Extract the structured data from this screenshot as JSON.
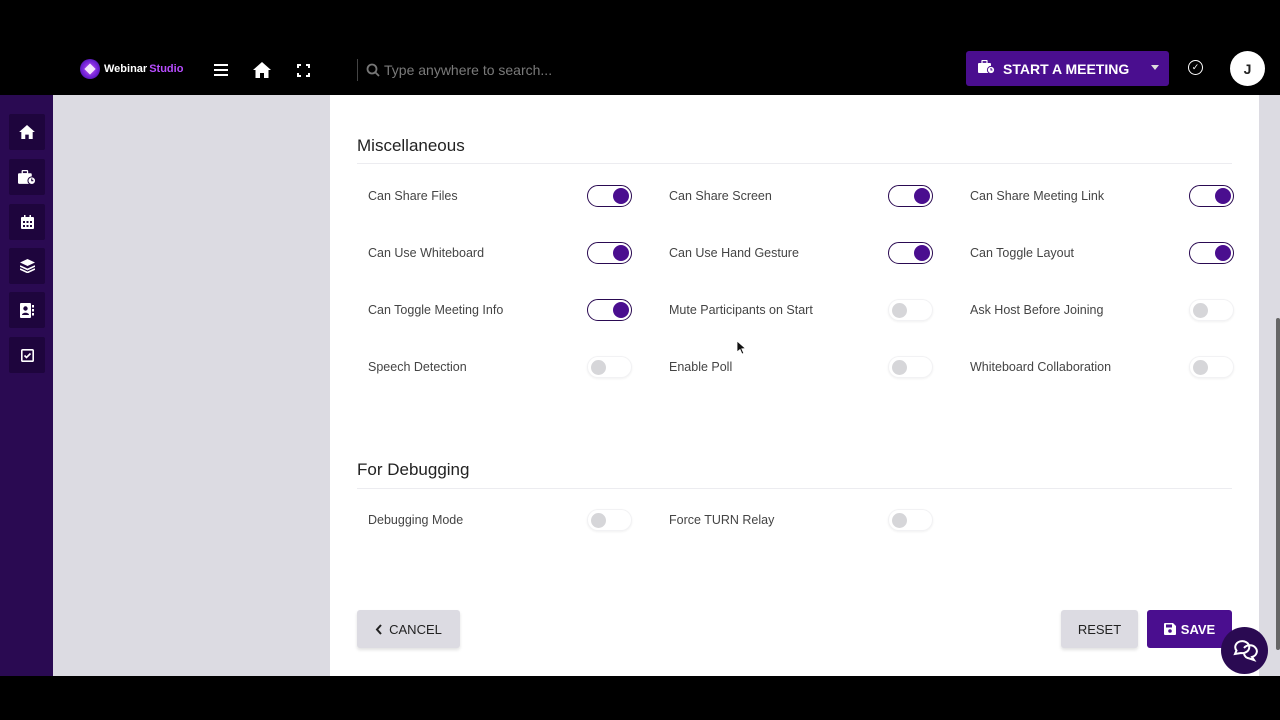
{
  "app": {
    "logo_part1": "Webinar",
    "logo_part2": "Studio"
  },
  "topbar": {
    "search_placeholder": "Type anywhere to search...",
    "start_meeting_label": "START A MEETING",
    "avatar_initial": "J"
  },
  "sidebar": {
    "items": [
      {
        "icon": "home-icon"
      },
      {
        "icon": "briefcase-clock-icon"
      },
      {
        "icon": "calendar-icon"
      },
      {
        "icon": "layers-icon"
      },
      {
        "icon": "contact-book-icon"
      },
      {
        "icon": "checkbox-icon"
      }
    ]
  },
  "sections": [
    {
      "title": "Miscellaneous",
      "settings": [
        {
          "label": "Can Share Files",
          "enabled": true
        },
        {
          "label": "Can Share Screen",
          "enabled": true
        },
        {
          "label": "Can Share Meeting Link",
          "enabled": true
        },
        {
          "label": "Can Use Whiteboard",
          "enabled": true
        },
        {
          "label": "Can Use Hand Gesture",
          "enabled": true
        },
        {
          "label": "Can Toggle Layout",
          "enabled": true
        },
        {
          "label": "Can Toggle Meeting Info",
          "enabled": true
        },
        {
          "label": "Mute Participants on Start",
          "enabled": false
        },
        {
          "label": "Ask Host Before Joining",
          "enabled": false
        },
        {
          "label": "Speech Detection",
          "enabled": false
        },
        {
          "label": "Enable Poll",
          "enabled": false
        },
        {
          "label": "Whiteboard Collaboration",
          "enabled": false
        }
      ]
    },
    {
      "title": "For Debugging",
      "settings": [
        {
          "label": "Debugging Mode",
          "enabled": false
        },
        {
          "label": "Force TURN Relay",
          "enabled": false
        }
      ]
    }
  ],
  "footer": {
    "cancel_label": "CANCEL",
    "reset_label": "RESET",
    "save_label": "SAVE"
  },
  "colors": {
    "accent": "#4a0e8f",
    "sidebar": "#2a0a52",
    "toggle_off": "#d6d6d9"
  }
}
